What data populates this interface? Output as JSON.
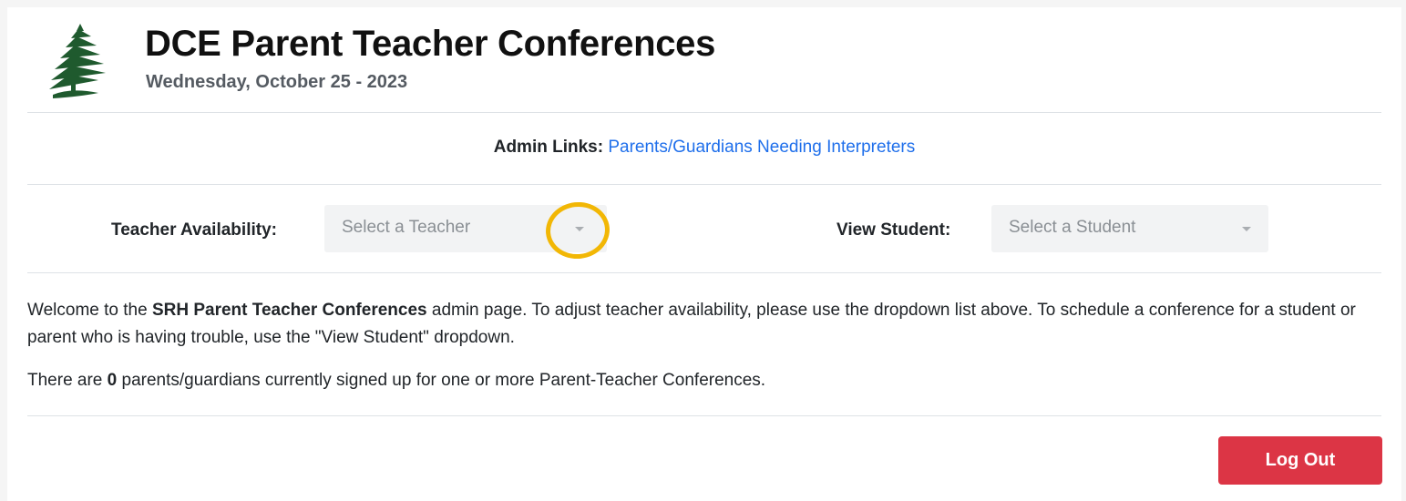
{
  "header": {
    "title": "DCE Parent Teacher Conferences",
    "subtitle": "Wednesday, October 25 - 2023",
    "logo_icon": "pine-tree-icon"
  },
  "admin": {
    "label": "Admin Links:",
    "link_text": "Parents/Guardians Needing Interpreters"
  },
  "filters": {
    "teacher_label": "Teacher Availability:",
    "teacher_placeholder": "Select a Teacher",
    "student_label": "View Student:",
    "student_placeholder": "Select a Student"
  },
  "welcome": {
    "part1": "Welcome to the ",
    "bold": "SRH Parent Teacher Conferences",
    "part2": " admin page. To adjust teacher availability, please use the dropdown list above. To schedule a conference for a student or parent who is having trouble, use the \"View Student\" dropdown."
  },
  "signup": {
    "part1": "There are ",
    "count": "0",
    "part2": " parents/guardians currently signed up for one or more Parent-Teacher Conferences."
  },
  "actions": {
    "logout_label": "Log Out"
  },
  "colors": {
    "link": "#1f6feb",
    "logout_bg": "#dc3545",
    "highlight": "#f2b705",
    "tree": "#1f5a2e"
  }
}
